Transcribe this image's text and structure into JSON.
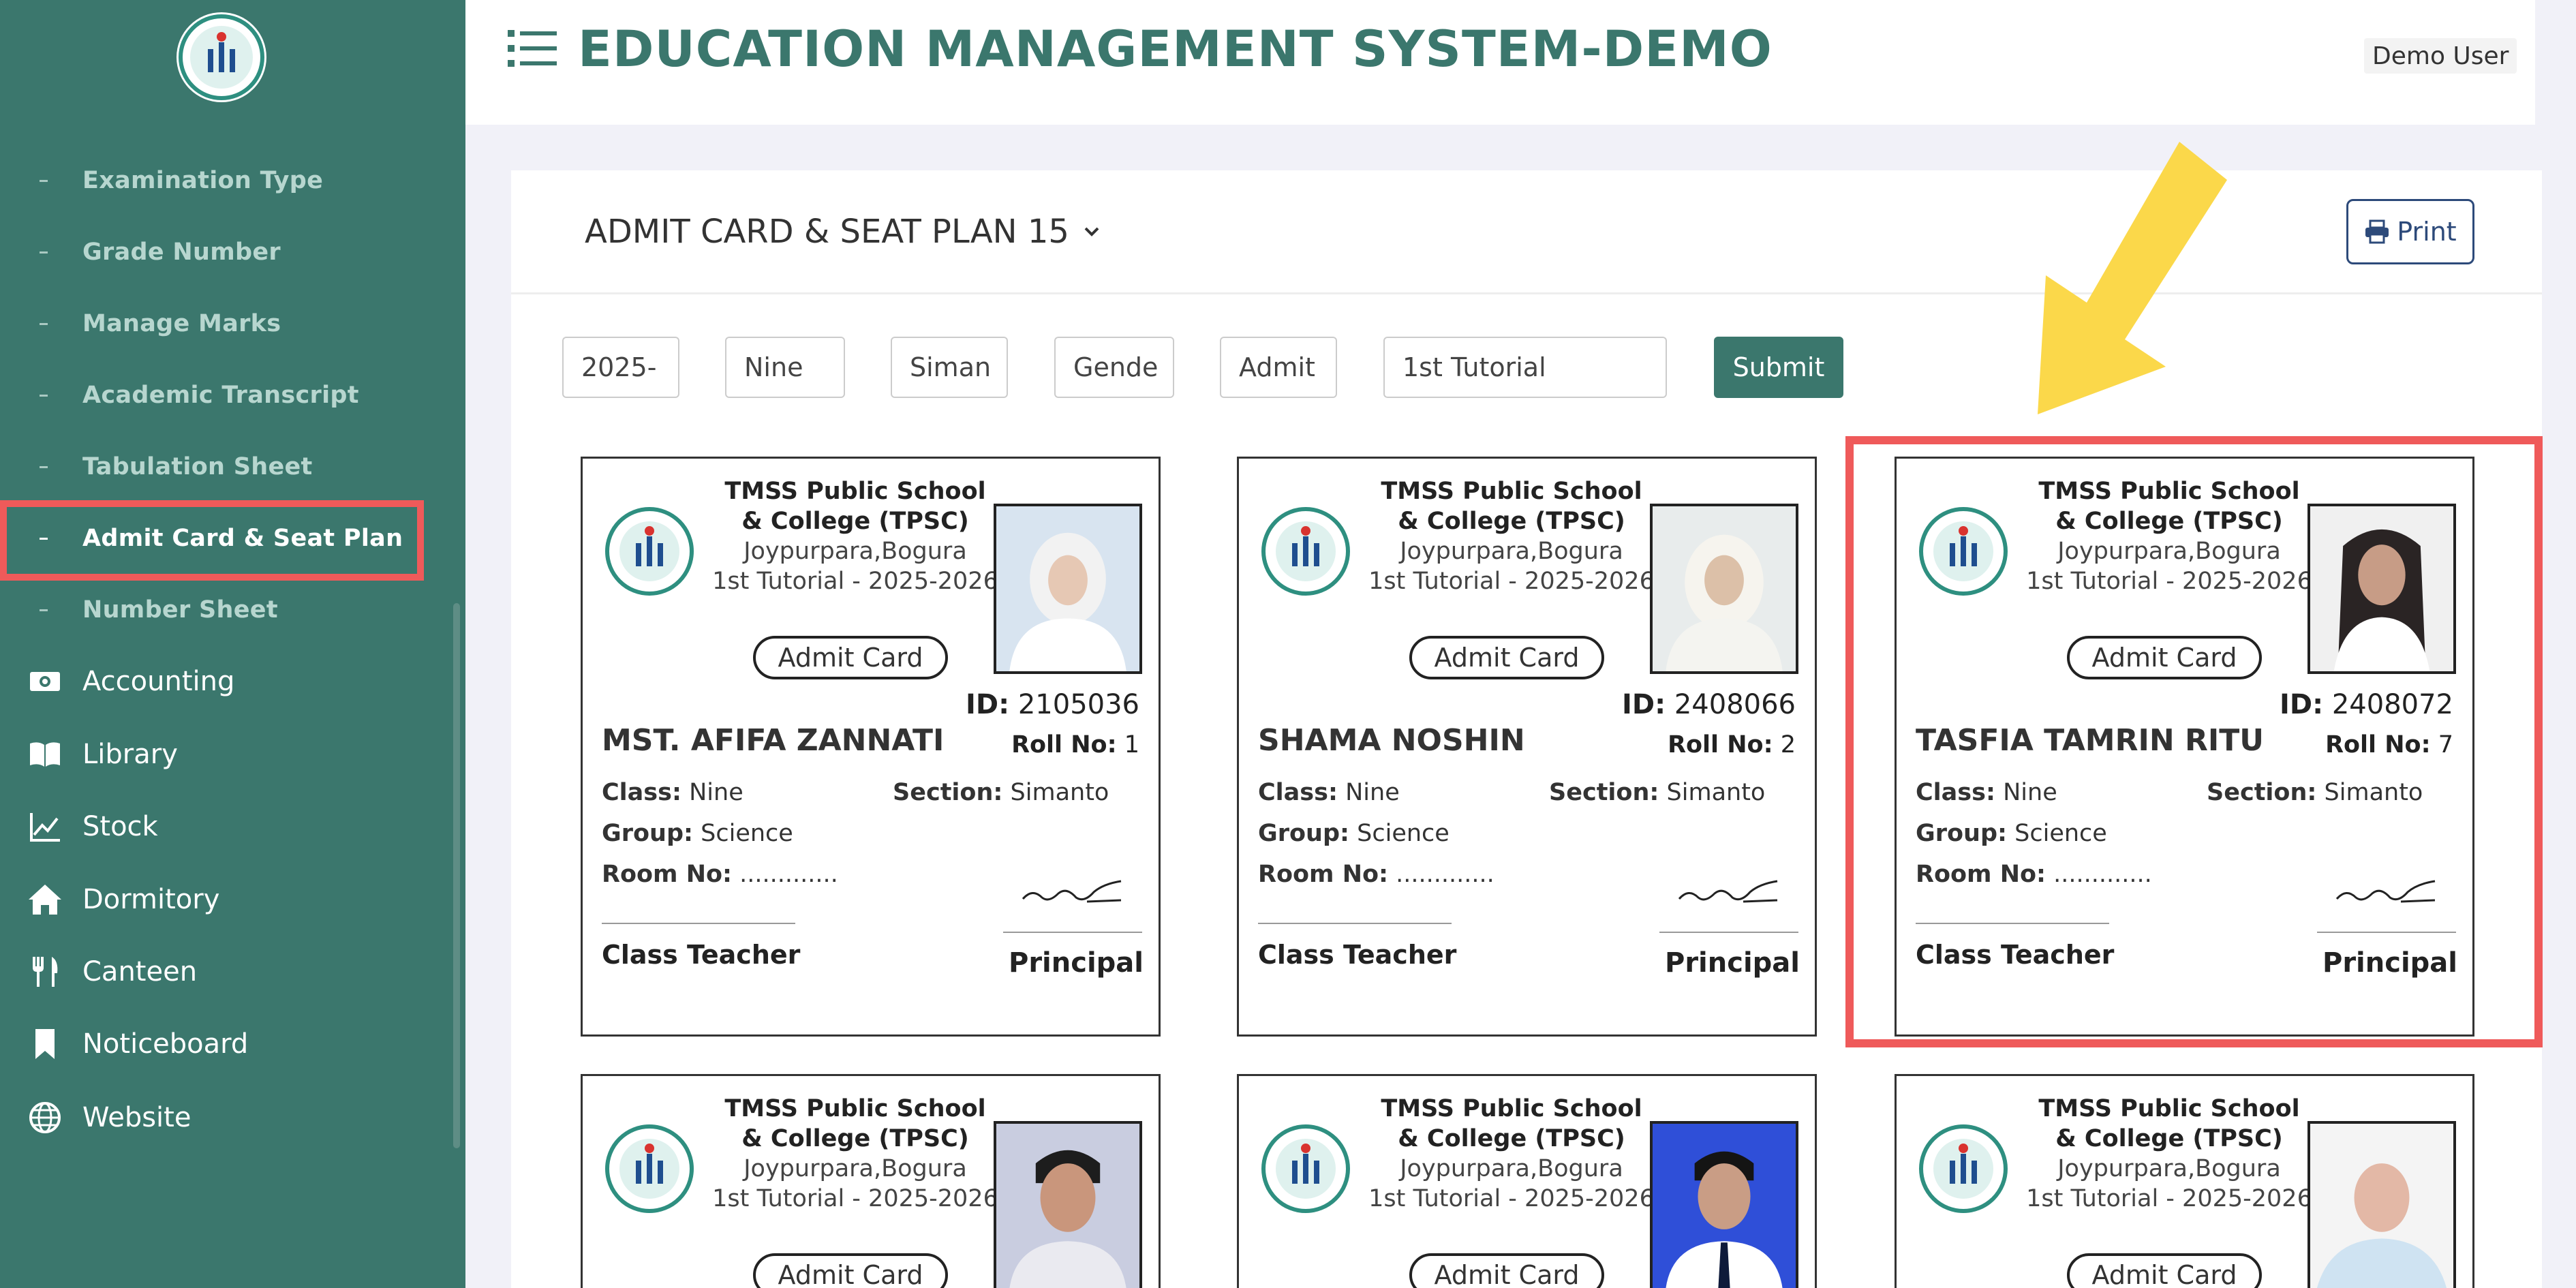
{
  "header": {
    "title": "EDUCATION MANAGEMENT SYSTEM-DEMO",
    "user_label": "Demo User"
  },
  "sidebar": {
    "sub_items": [
      {
        "label": "Examination Type"
      },
      {
        "label": "Grade Number"
      },
      {
        "label": "Manage Marks"
      },
      {
        "label": "Academic Transcript"
      },
      {
        "label": "Tabulation Sheet"
      },
      {
        "label": "Admit Card & Seat Plan"
      },
      {
        "label": "Number Sheet"
      }
    ],
    "main_items": [
      {
        "label": "Accounting",
        "icon": "money-icon"
      },
      {
        "label": "Library",
        "icon": "book-icon"
      },
      {
        "label": "Stock",
        "icon": "chart-icon"
      },
      {
        "label": "Dormitory",
        "icon": "home-icon"
      },
      {
        "label": "Canteen",
        "icon": "utensils-icon"
      },
      {
        "label": "Noticeboard",
        "icon": "bookmark-icon"
      },
      {
        "label": "Website",
        "icon": "globe-icon"
      }
    ]
  },
  "panel": {
    "title": "ADMIT CARD & SEAT PLAN 15",
    "print_label": "Print",
    "submit_label": "Submit",
    "filters": [
      "2025-",
      "Nine",
      "Siman",
      "Gende",
      "Admit",
      "1st Tutorial"
    ]
  },
  "cards": [
    {
      "school": "TMSS Public School & College (TPSC)",
      "address": "Joypurpara,Bogura",
      "exam": "1st Tutorial - 2025-2026",
      "badge": "Admit Card",
      "id": "2105036",
      "roll": "1",
      "name": "MST. AFIFA ZANNATI",
      "class": "Nine",
      "section": "Simanto",
      "group": "Science",
      "room": ".............",
      "teacher": "Class Teacher",
      "principal": "Principal"
    },
    {
      "school": "TMSS Public School & College (TPSC)",
      "address": "Joypurpara,Bogura",
      "exam": "1st Tutorial - 2025-2026",
      "badge": "Admit Card",
      "id": "2408066",
      "roll": "2",
      "name": "SHAMA NOSHIN",
      "class": "Nine",
      "section": "Simanto",
      "group": "Science",
      "room": ".............",
      "teacher": "Class Teacher",
      "principal": "Principal"
    },
    {
      "school": "TMSS Public School & College (TPSC)",
      "address": "Joypurpara,Bogura",
      "exam": "1st Tutorial - 2025-2026",
      "badge": "Admit Card",
      "id": "2408072",
      "roll": "7",
      "name": "TASFIA TAMRIN RITU",
      "class": "Nine",
      "section": "Simanto",
      "group": "Science",
      "room": ".............",
      "teacher": "Class Teacher",
      "principal": "Principal"
    },
    {
      "school": "TMSS Public School & College (TPSC)",
      "address": "Joypurpara,Bogura",
      "exam": "1st Tutorial - 2025-2026",
      "badge": "Admit Card"
    },
    {
      "school": "TMSS Public School & College (TPSC)",
      "address": "Joypurpara,Bogura",
      "exam": "1st Tutorial - 2025-2026",
      "badge": "Admit Card"
    },
    {
      "school": "TMSS Public School & College (TPSC)",
      "address": "Joypurpara,Bogura",
      "exam": "1st Tutorial - 2025-2026",
      "badge": "Admit Card"
    }
  ],
  "labels": {
    "id": "ID:",
    "roll": "Roll No:",
    "class": "Class:",
    "section": "Section:",
    "group": "Group:",
    "room": "Room No:"
  },
  "colors": {
    "sidebar": "#3b776d",
    "accent": "#3b776d",
    "highlight": "#ef5a5a",
    "arrow": "#fbd84a"
  }
}
